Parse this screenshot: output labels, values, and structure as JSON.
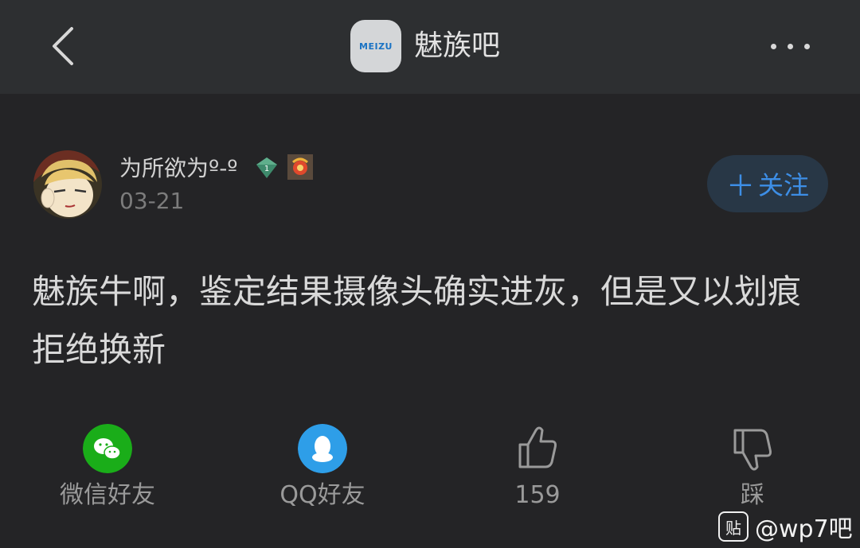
{
  "header": {
    "back_icon": "chevron-left-icon",
    "logo_text": "MEIZU",
    "title": "魅族吧",
    "more_icon": "more-dots-icon"
  },
  "post": {
    "username": "为所欲为º-º",
    "level": "1",
    "date": "03-21",
    "follow_label": "关注",
    "content": "魅族牛啊，鉴定结果摄像头确实进灰，但是又以划痕拒绝换新"
  },
  "actions": {
    "wechat_label": "微信好友",
    "qq_label": "QQ好友",
    "like_count": "159",
    "dislike_label": "踩"
  },
  "watermark": {
    "icon_text": "贴",
    "text": "@wp7吧"
  },
  "colors": {
    "background": "#242426",
    "topbar": "#2d2f31",
    "accent": "#3d8ee6",
    "wechat": "#1aad19",
    "qq": "#2e9ee8"
  }
}
